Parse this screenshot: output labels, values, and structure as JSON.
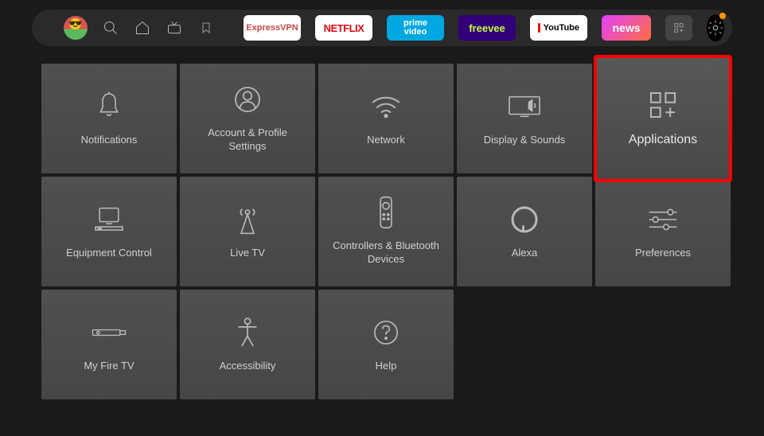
{
  "topbar": {
    "apps": [
      {
        "id": "expressvpn",
        "label": "ExpressVPN"
      },
      {
        "id": "netflix",
        "label": "NETFLIX"
      },
      {
        "id": "primevideo",
        "label": "prime video"
      },
      {
        "id": "freevee",
        "label": "freevee"
      },
      {
        "id": "youtube",
        "label": "YouTube"
      },
      {
        "id": "news",
        "label": "news"
      }
    ]
  },
  "settings": {
    "tiles": [
      {
        "id": "notifications",
        "label": "Notifications"
      },
      {
        "id": "account",
        "label": "Account & Profile Settings"
      },
      {
        "id": "network",
        "label": "Network"
      },
      {
        "id": "display",
        "label": "Display & Sounds"
      },
      {
        "id": "applications",
        "label": "Applications",
        "highlighted": true
      },
      {
        "id": "equipment",
        "label": "Equipment Control"
      },
      {
        "id": "livetv",
        "label": "Live TV"
      },
      {
        "id": "controllers",
        "label": "Controllers & Bluetooth Devices"
      },
      {
        "id": "alexa",
        "label": "Alexa"
      },
      {
        "id": "preferences",
        "label": "Preferences"
      },
      {
        "id": "myfiretv",
        "label": "My Fire TV"
      },
      {
        "id": "accessibility",
        "label": "Accessibility"
      },
      {
        "id": "help",
        "label": "Help"
      }
    ]
  }
}
